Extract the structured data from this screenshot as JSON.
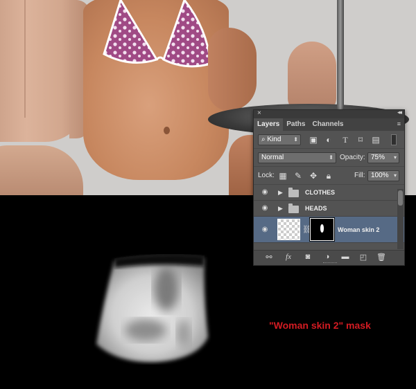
{
  "panel": {
    "close_glyph": "×",
    "collapse_glyph": "◂◂",
    "menu_glyph": "≡",
    "tabs": [
      {
        "label": "Layers",
        "active": true
      },
      {
        "label": "Paths",
        "active": false
      },
      {
        "label": "Channels",
        "active": false
      }
    ],
    "filter": {
      "kind_label": "Kind",
      "search_icon": "search-icon",
      "filter_icons": [
        "image-filter-icon",
        "adjustment-filter-icon",
        "type-filter-icon",
        "shape-filter-icon",
        "smart-object-filter-icon",
        "filter-toggle-icon"
      ]
    },
    "blend_mode": "Normal",
    "opacity_label": "Opacity:",
    "opacity_value": "75%",
    "lock_label": "Lock:",
    "lock_icons": [
      "lock-transparent-icon",
      "lock-image-icon",
      "lock-position-icon",
      "lock-all-icon"
    ],
    "fill_label": "Fill:",
    "fill_value": "100%",
    "layers": [
      {
        "name": "CLOTHES",
        "type": "group",
        "visible": true
      },
      {
        "name": "HEADS",
        "type": "group",
        "visible": true
      },
      {
        "name": "Woman skin 2",
        "type": "layer",
        "visible": true,
        "selected": true,
        "has_mask": true
      }
    ],
    "footer_icons": [
      "link-layers-icon",
      "fx-icon",
      "add-mask-icon",
      "adjustment-layer-icon",
      "new-group-icon",
      "new-layer-icon",
      "trash-icon"
    ],
    "fx_label": "fx",
    "colors": {
      "panel_bg": "#535353",
      "selected_row": "#566a85",
      "tab_bar": "#424242"
    }
  },
  "caption": {
    "text": "\"Woman skin 2\" mask",
    "color": "#d31b22"
  },
  "canvas": {
    "photo_bg": "#cfcdcb",
    "mask_bg": "#000000"
  }
}
